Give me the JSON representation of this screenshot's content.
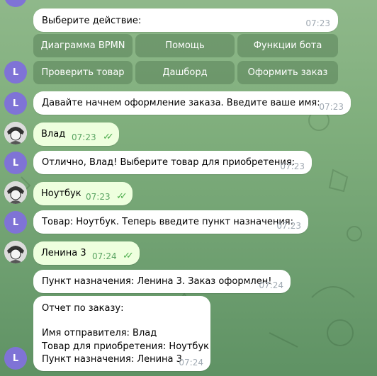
{
  "menu_message": {
    "text": "Выберите действие:",
    "time": "07:23"
  },
  "keyboard": {
    "row1": [
      "Диаграмма BPMN",
      "Помощь",
      "Функции бота"
    ],
    "row2": [
      "Проверить товар",
      "Дашборд",
      "Оформить заказ"
    ]
  },
  "avatar_letter": "L",
  "messages": [
    {
      "text": "Давайте начнем оформление заказа. Введите ваше имя:",
      "time": "07:23"
    },
    {
      "text": "Влад",
      "time": "07:23"
    },
    {
      "text": "Отлично, Влад! Выберите товар для приобретения:",
      "time": "07:23"
    },
    {
      "text": "Ноутбук",
      "time": "07:23"
    },
    {
      "text": "Товар: Ноутбук. Теперь введите пункт назначения:",
      "time": "07:23"
    },
    {
      "text": "Ленина 3",
      "time": "07:24"
    },
    {
      "text": "Пункт назначения: Ленина 3. Заказ оформлен!",
      "time": "07:24"
    }
  ],
  "report": {
    "lines": [
      "Отчет по заказу:",
      "Имя отправителя: Влад",
      "Товар для приобретения: Ноутбук",
      "Пункт назначения: Ленина 3"
    ],
    "time": "07:24"
  }
}
